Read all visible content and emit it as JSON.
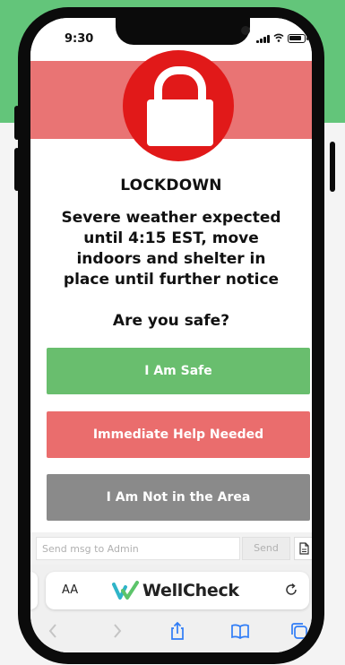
{
  "status_bar": {
    "time": "9:30"
  },
  "alert": {
    "title": "LOCKDOWN",
    "message": "Severe weather expected until 4:15 EST, move indoors and shelter in place until further notice",
    "question": "Are you safe?"
  },
  "responses": {
    "safe": "I Am Safe",
    "help": "Immediate Help Needed",
    "away": "I Am Not in the Area"
  },
  "message_bar": {
    "placeholder": "Send msg to Admin",
    "send_label": "Send"
  },
  "browser": {
    "text_size_label": "AA",
    "site_name": "WellCheck"
  },
  "colors": {
    "brand_green": "#63c57a",
    "alert_red": "#e11919",
    "safe_green": "#69be6e",
    "help_red": "#ea6d6d",
    "away_gray": "#8a8a8a"
  },
  "icons": [
    "lock-icon",
    "signal-icon",
    "wifi-icon",
    "battery-icon",
    "attach-file-icon",
    "reload-icon",
    "back-icon",
    "forward-icon",
    "share-icon",
    "bookmarks-icon",
    "tabs-icon"
  ]
}
